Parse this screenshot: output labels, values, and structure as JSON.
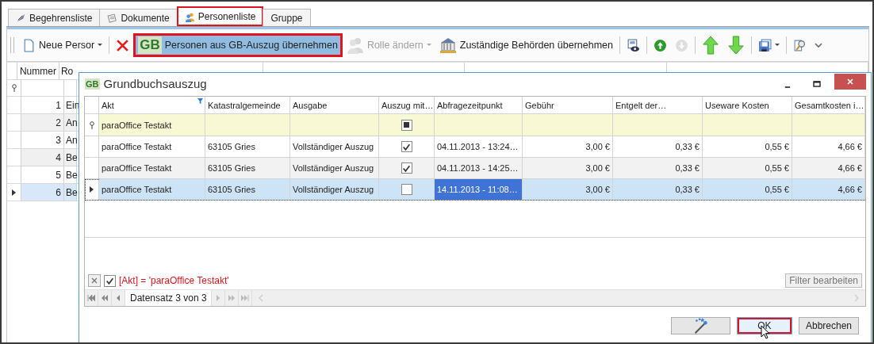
{
  "tabs": [
    {
      "label": "Begehrensliste",
      "selected": false,
      "highlighted": false
    },
    {
      "label": "Dokumente",
      "selected": false,
      "highlighted": false
    },
    {
      "label": "Personenliste",
      "selected": true,
      "highlighted": true
    },
    {
      "label": "Gruppe",
      "selected": false,
      "highlighted": false
    }
  ],
  "toolbar": [
    {
      "label": "Neue Persor",
      "dropdown": true,
      "disabled": false,
      "highlighted": false
    },
    {
      "dropdown": false,
      "disabled": false,
      "highlighted": false
    },
    {
      "badge": "GB",
      "label": "Personen aus GB-Auszug übernehmen",
      "dropdown": false,
      "disabled": false,
      "highlighted": true
    },
    {
      "label": "Rolle ändern",
      "dropdown": true,
      "disabled": true,
      "highlighted": false
    },
    {
      "label": "Zuständige Behörden übernehmen",
      "dropdown": false,
      "disabled": false,
      "highlighted": false
    },
    {
      "dropdown": false,
      "disabled": false,
      "highlighted": false
    },
    {
      "dropdown": false,
      "disabled": false,
      "highlighted": false
    },
    {
      "dropdown": false,
      "disabled": true,
      "highlighted": false
    },
    {
      "dropdown": false,
      "disabled": false,
      "highlighted": false
    },
    {
      "dropdown": false,
      "disabled": false,
      "highlighted": false
    },
    {
      "dropdown": true,
      "disabled": false,
      "highlighted": false
    },
    {
      "dropdown": false,
      "disabled": false,
      "highlighted": false
    },
    {
      "dropdown": false,
      "disabled": false,
      "highlighted": false
    }
  ],
  "person_grid": {
    "columns": [
      "Nummer",
      "Ro"
    ],
    "rows": [
      {
        "nummer": "1",
        "column_2": "Ein",
        "selected": false
      },
      {
        "nummer": "2",
        "column_2": "An",
        "selected": false
      },
      {
        "nummer": "3",
        "column_2": "An",
        "selected": false
      },
      {
        "nummer": "4",
        "column_2": "Be",
        "selected": false
      },
      {
        "nummer": "5",
        "column_2": "Be",
        "selected": false
      },
      {
        "nummer": "6",
        "column_2": "Be",
        "selected": true
      }
    ]
  },
  "dialog": {
    "badge": "GB",
    "title": "Grundbuchsauszug",
    "columns": [
      {
        "label": "Akt",
        "filtered": true
      },
      {
        "label": "Katastralgemeinde",
        "filtered": false
      },
      {
        "label": "Ausgabe",
        "filtered": false
      },
      {
        "label": "Auszug mit…",
        "filtered": false
      },
      {
        "label": "Abfragezeitpunkt",
        "filtered": false
      },
      {
        "label": "Gebühr",
        "filtered": false
      },
      {
        "label": "Entgelt der…",
        "filtered": false
      },
      {
        "label": "Useware Kosten",
        "filtered": false
      },
      {
        "label": "Gesamtkosten i…",
        "filtered": false
      }
    ],
    "filter_row": {
      "akt": "paraOffice Testakt",
      "auszug_mit_indeterminate": true
    },
    "rows": [
      {
        "akt": "paraOffice Testakt",
        "katastralgemeinde": "63105 Gries",
        "ausgabe": "Vollständiger Auszug",
        "auszug_mit": true,
        "abfragezeitpunkt": "04.11.2013 - 13:24…",
        "gebuehr": "3,00 €",
        "entgelt": "0,33 €",
        "useware": "0,55 €",
        "gesamt": "4,66 €",
        "selected": false
      },
      {
        "akt": "paraOffice Testakt",
        "katastralgemeinde": "63105 Gries",
        "ausgabe": "Vollständiger Auszug",
        "auszug_mit": true,
        "abfragezeitpunkt": "04.11.2013 - 14:25…",
        "gebuehr": "3,00 €",
        "entgelt": "0,33 €",
        "useware": "0,55 €",
        "gesamt": "4,66 €",
        "selected": false
      },
      {
        "akt": "paraOffice Testakt",
        "katastralgemeinde": "63105 Gries",
        "ausgabe": "Vollständiger Auszug",
        "auszug_mit": false,
        "abfragezeitpunkt": "14.11.2013 - 11:08…",
        "gebuehr": "3,00 €",
        "entgelt": "0,33 €",
        "useware": "0,55 €",
        "gesamt": "4,66 €",
        "selected": true
      }
    ],
    "filter_panel": {
      "enabled": true,
      "expression": "[Akt] = 'paraOffice Testakt'",
      "edit_button": "Filter bearbeiten"
    },
    "navigator": {
      "text": "Datensatz 3 von 3"
    },
    "buttons": [
      {
        "kind": "wizard",
        "highlighted": false
      },
      {
        "kind": "text",
        "label": "OK",
        "highlighted": true
      },
      {
        "kind": "text",
        "label": "Abbrechen",
        "highlighted": false
      }
    ]
  }
}
